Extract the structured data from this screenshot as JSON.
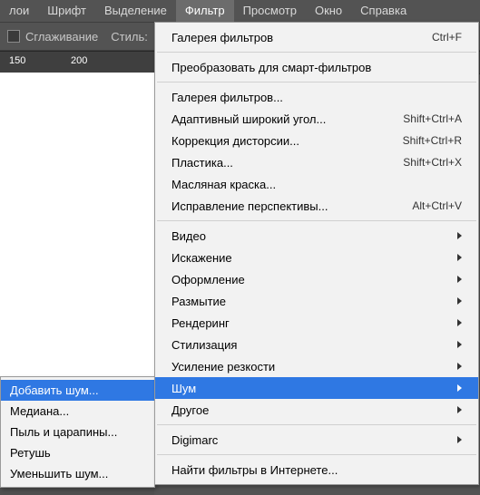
{
  "menubar": {
    "items": [
      "лои",
      "Шрифт",
      "Выделение",
      "Фильтр",
      "Просмотр",
      "Окно",
      "Справка"
    ],
    "activeIndex": 3
  },
  "optionsbar": {
    "antialias_label": "Сглаживание",
    "style_label": "Стиль:"
  },
  "ruler": {
    "ticks": [
      "150",
      "200"
    ]
  },
  "dropdown": {
    "gallery_last": "Галерея фильтров",
    "gallery_last_sc": "Ctrl+F",
    "convert_smart": "Преобразовать для смарт-фильтров",
    "gallery": "Галерея фильтров...",
    "adaptive": "Адаптивный широкий угол...",
    "adaptive_sc": "Shift+Ctrl+A",
    "lens": "Коррекция дисторсии...",
    "lens_sc": "Shift+Ctrl+R",
    "liquify": "Пластика...",
    "liquify_sc": "Shift+Ctrl+X",
    "oil": "Масляная краска...",
    "vanish": "Исправление перспективы...",
    "vanish_sc": "Alt+Ctrl+V",
    "video": "Видео",
    "distort": "Искажение",
    "pixelate": "Оформление",
    "blur": "Размытие",
    "render": "Рендеринг",
    "stylize": "Стилизация",
    "sharpen": "Усиление резкости",
    "noise": "Шум",
    "other": "Другое",
    "digimarc": "Digimarc",
    "browse": "Найти фильтры в Интернете..."
  },
  "submenu": {
    "add_noise": "Добавить шум...",
    "median": "Медиана...",
    "dust": "Пыль и царапины...",
    "despeckle": "Ретушь",
    "reduce": "Уменьшить шум..."
  }
}
